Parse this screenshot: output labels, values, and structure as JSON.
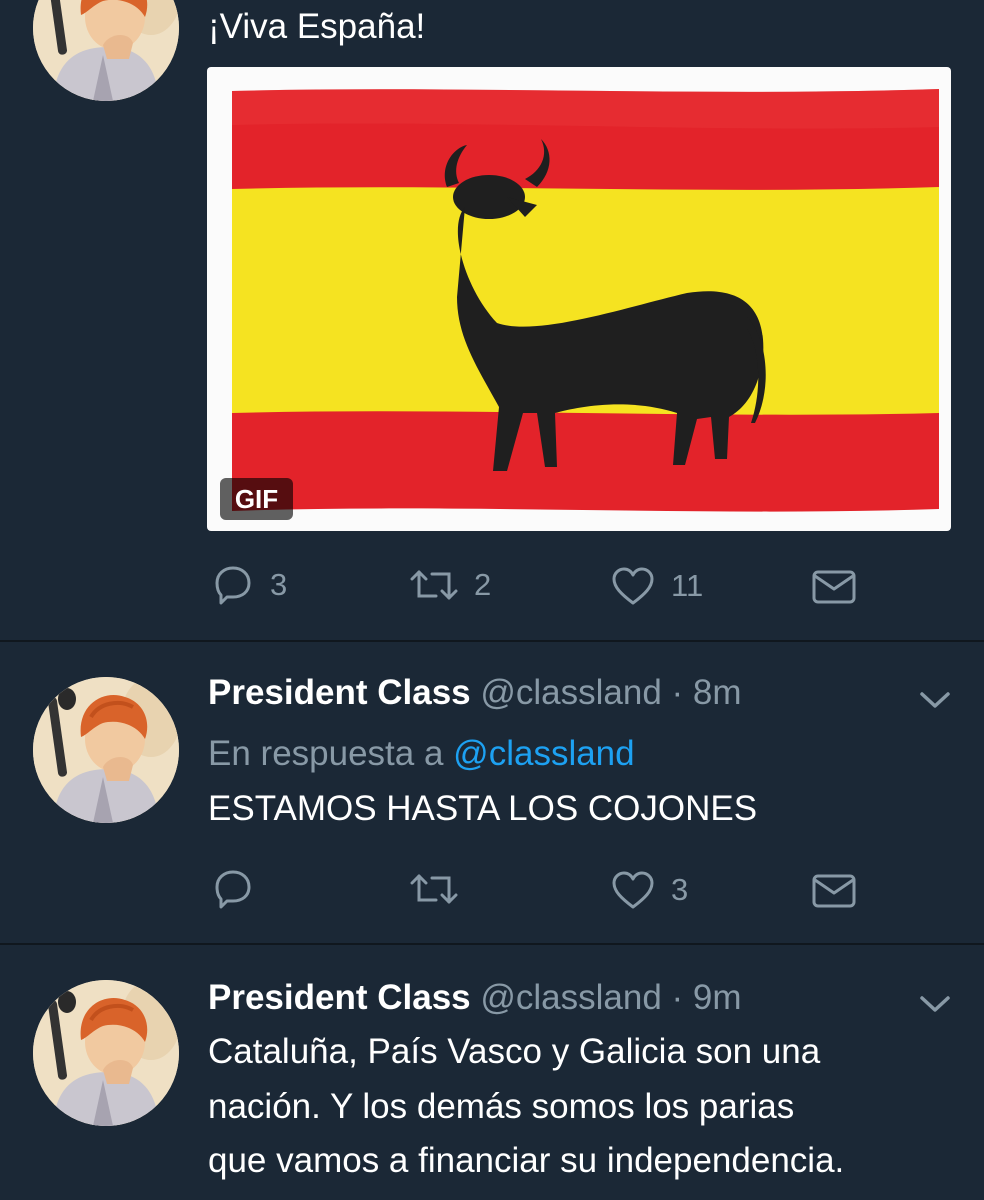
{
  "tweets": [
    {
      "text": "¡Viva España!",
      "media": {
        "badge": "GIF",
        "flag_colors": {
          "red": "#e3232a",
          "yellow": "#f5e321",
          "bull": "#1f1f1f"
        }
      },
      "actions": {
        "reply": "3",
        "retweet": "2",
        "like": "11"
      }
    },
    {
      "name": "President Class",
      "handle": "@classland",
      "time": "· 8m",
      "reply_prefix": "En respuesta a",
      "reply_to": "@classland",
      "text": "ESTAMOS HASTA LOS COJONES",
      "actions": {
        "reply": "",
        "retweet": "",
        "like": "3"
      }
    },
    {
      "name": "President Class",
      "handle": "@classland",
      "time": "· 9m",
      "text_lines": [
        "Cataluña, País Vasco y Galicia son una",
        "nación. Y los demás somos los parias",
        "que vamos a financiar su independencia."
      ]
    }
  ],
  "icons": [
    "reply-icon",
    "retweet-icon",
    "like-icon",
    "direct-message-icon",
    "chevron-down-icon"
  ],
  "colors": {
    "background": "#1b2836",
    "separator": "#10171e",
    "muted": "#8899a6",
    "link": "#1da1f2"
  }
}
